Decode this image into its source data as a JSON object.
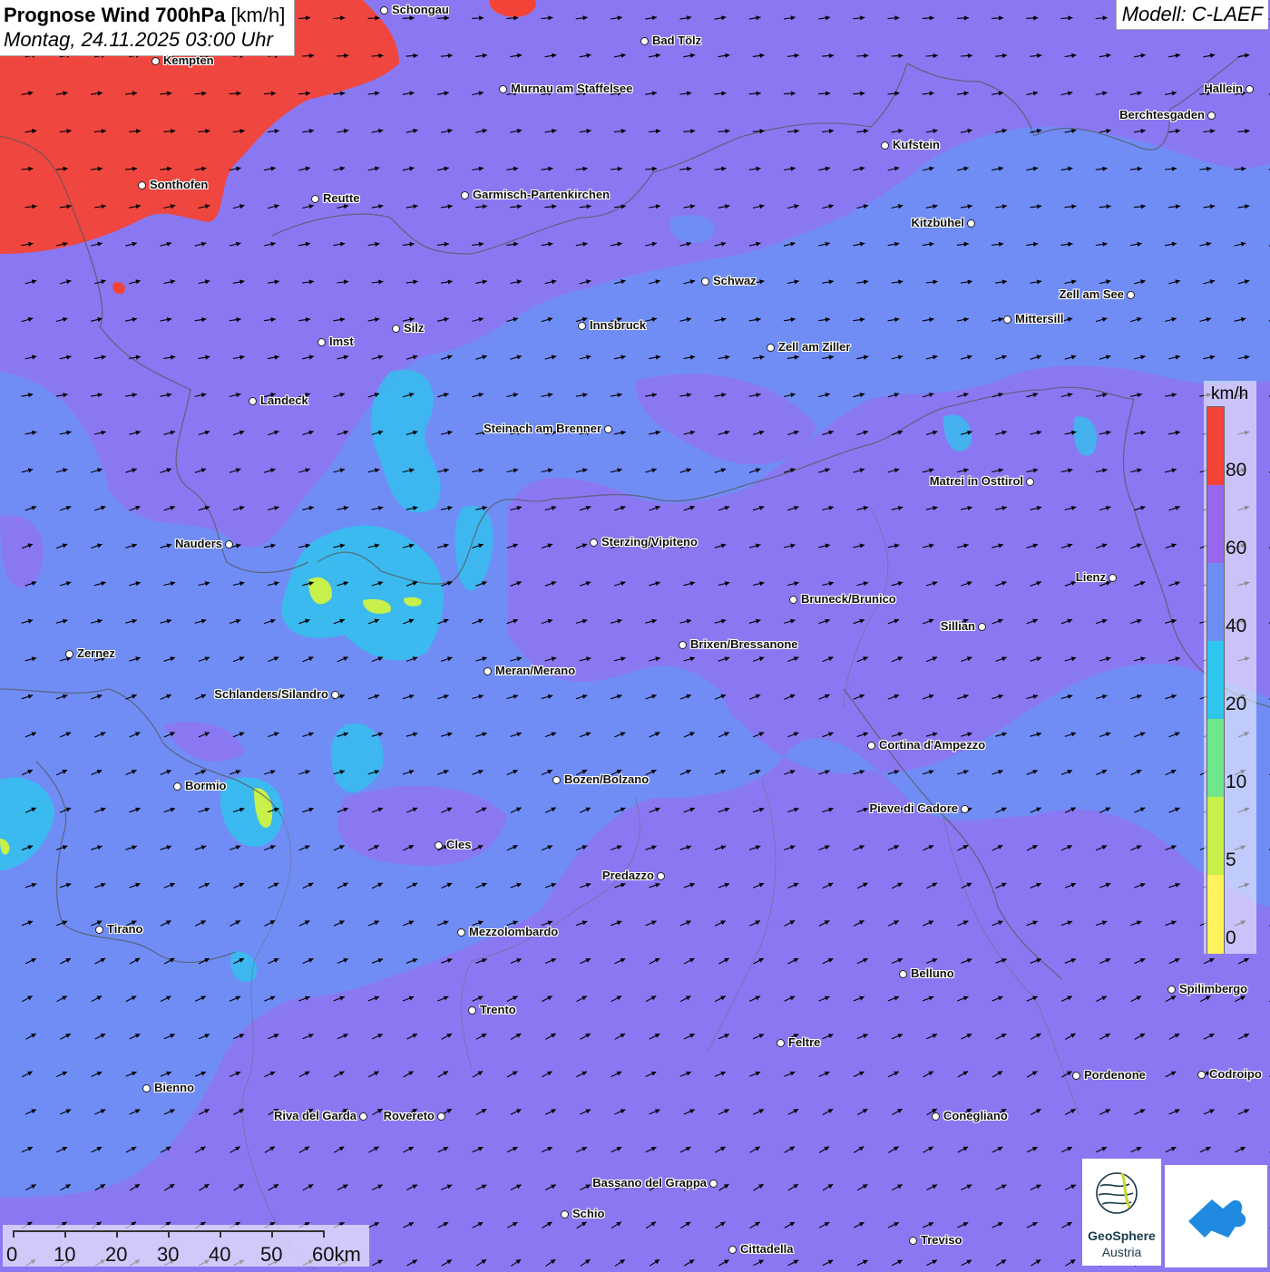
{
  "title": {
    "bold": "Prognose Wind 700hPa",
    "unit": " [km/h]",
    "date": "Montag, 24.11.2025 03:00 Uhr"
  },
  "model": "Modell: C-LAEF",
  "legend": {
    "unit": "km/h",
    "ticks": [
      "80",
      "60",
      "40",
      "20",
      "10",
      "5",
      "0"
    ],
    "colors": [
      "#f44336",
      "#9966ee",
      "#6f8ef5",
      "#2ec5ee",
      "#6fe88b",
      "#c8f04a",
      "#fff35c"
    ]
  },
  "scale": {
    "labels": [
      "0",
      "10",
      "20",
      "30",
      "40",
      "50",
      "60km"
    ]
  },
  "logos": {
    "geosphere_line1": "GeoSphere",
    "geosphere_line2": "Austria"
  },
  "cities": [
    {
      "name": "Schongau"
    },
    {
      "name": "Bad Tölz"
    },
    {
      "name": "Kempten"
    },
    {
      "name": "Murnau am Staffelsee"
    },
    {
      "name": "Hallein"
    },
    {
      "name": "Berchtesgaden"
    },
    {
      "name": "Kufstein"
    },
    {
      "name": "Sonthofen"
    },
    {
      "name": "Reutte"
    },
    {
      "name": "Garmisch-Partenkirchen"
    },
    {
      "name": "Kitzbühel"
    },
    {
      "name": "Schwaz"
    },
    {
      "name": "Zell am See"
    },
    {
      "name": "Mittersill"
    },
    {
      "name": "Innsbruck"
    },
    {
      "name": "Silz"
    },
    {
      "name": "Imst"
    },
    {
      "name": "Zell am Ziller"
    },
    {
      "name": "Landeck"
    },
    {
      "name": "Steinach am Brenner"
    },
    {
      "name": "Matrei in Osttirol"
    },
    {
      "name": "Nauders"
    },
    {
      "name": "Sterzing/Vipiteno"
    },
    {
      "name": "Lienz"
    },
    {
      "name": "Bruneck/Brunico"
    },
    {
      "name": "Sillian"
    },
    {
      "name": "Zernez"
    },
    {
      "name": "Brixen/Bressanone"
    },
    {
      "name": "Meran/Merano"
    },
    {
      "name": "Schlanders/Silandro"
    },
    {
      "name": "Cortina d'Ampezzo"
    },
    {
      "name": "Bozen/Bolzano"
    },
    {
      "name": "Bormio"
    },
    {
      "name": "Pieve di Cadore"
    },
    {
      "name": "Cles"
    },
    {
      "name": "Predazzo"
    },
    {
      "name": "Tirano"
    },
    {
      "name": "Mezzolombardo"
    },
    {
      "name": "Belluno"
    },
    {
      "name": "Spilimbergo"
    },
    {
      "name": "Trento"
    },
    {
      "name": "Feltre"
    },
    {
      "name": "Pordenone"
    },
    {
      "name": "Codroipo"
    },
    {
      "name": "Bienno"
    },
    {
      "name": "Riva del Garda"
    },
    {
      "name": "Rovereto"
    },
    {
      "name": "Conegliano"
    },
    {
      "name": "Bassano del Grappa"
    },
    {
      "name": "Schio"
    },
    {
      "name": "Treviso"
    },
    {
      "name": "Cittadella"
    }
  ]
}
